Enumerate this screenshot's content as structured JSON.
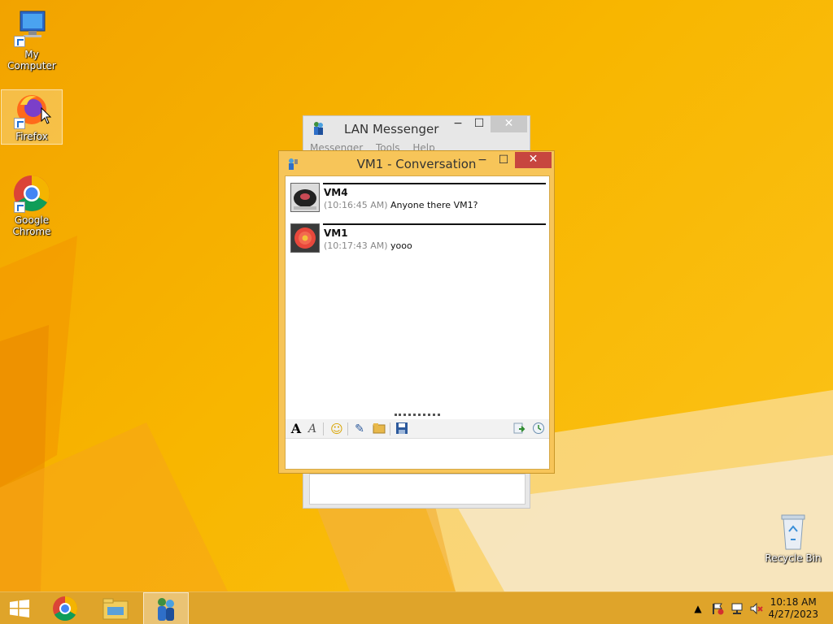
{
  "desktop": {
    "icons": [
      {
        "label": "My Computer",
        "icon": "computer-icon"
      },
      {
        "label": "Firefox",
        "icon": "firefox-icon"
      },
      {
        "label": "Google Chrome",
        "icon": "chrome-icon"
      },
      {
        "label": "Recycle Bin",
        "icon": "recycle-bin-icon"
      }
    ]
  },
  "lan_window": {
    "title": "LAN Messenger",
    "menu": [
      "Messenger",
      "Tools",
      "Help"
    ]
  },
  "conversation": {
    "title": "VM1 - Conversation",
    "messages": [
      {
        "sender": "VM4",
        "time": "(10:16:45 AM)",
        "text": "Anyone there VM1?"
      },
      {
        "sender": "VM1",
        "time": "(10:17:43 AM)",
        "text": "yooo"
      }
    ],
    "toolbar": [
      "font-icon",
      "font-color-icon",
      "smiley-icon",
      "attach-file-icon",
      "send-folder-icon",
      "save-icon",
      "broadcast-icon",
      "history-icon"
    ]
  },
  "taskbar": {
    "items": [
      "start-icon",
      "chrome-icon",
      "file-explorer-icon",
      "lan-messenger-icon"
    ],
    "tray": [
      "show-hidden-icon",
      "action-center-icon",
      "network-icon",
      "volume-muted-icon"
    ],
    "time": "10:18 AM",
    "date": "4/27/2023"
  },
  "colors": {
    "accent": "#f7a800",
    "close": "#c7463f",
    "window_frame": "#f7c559"
  }
}
